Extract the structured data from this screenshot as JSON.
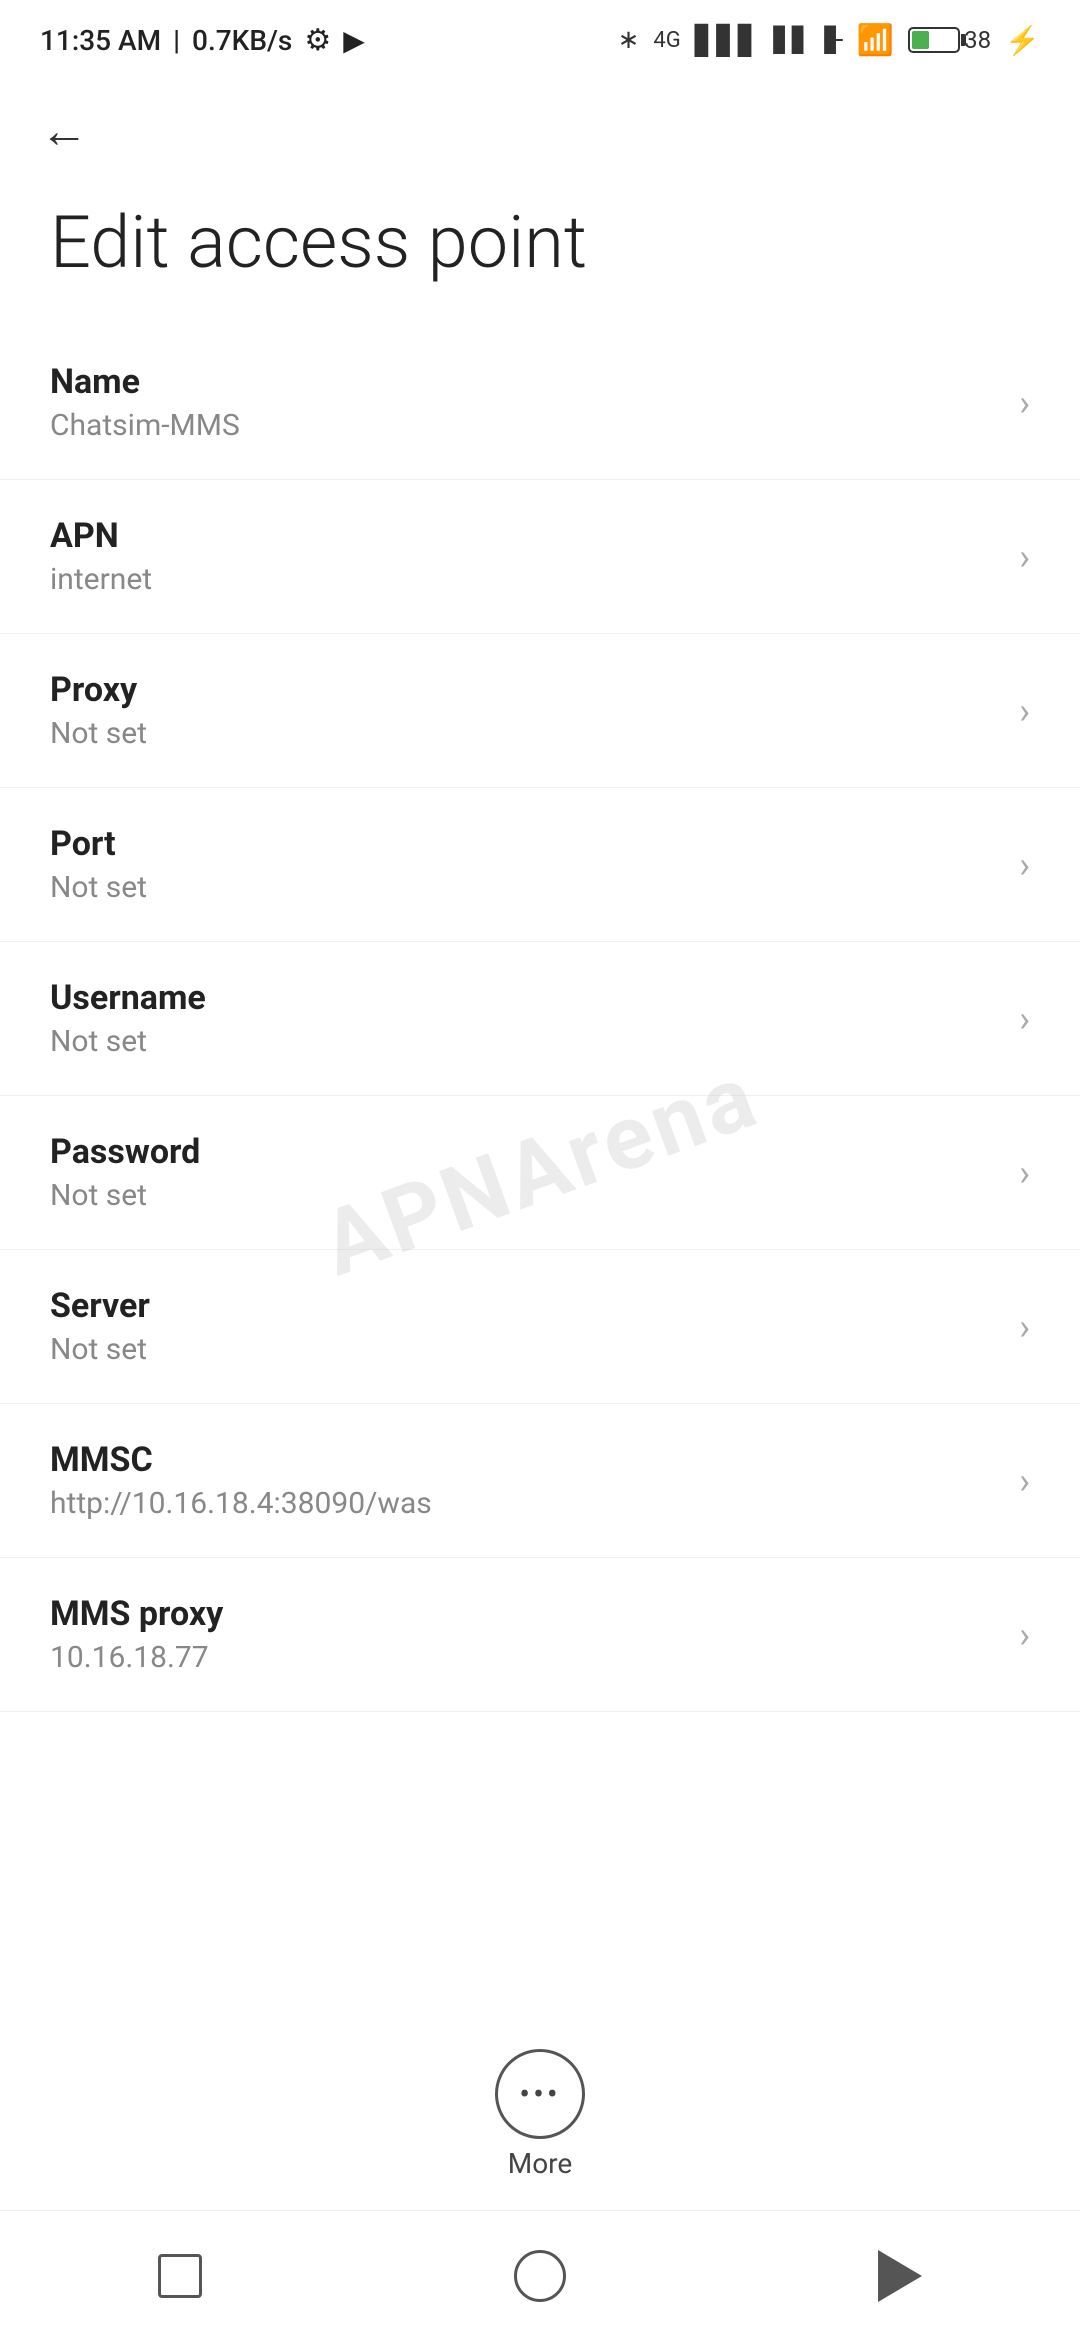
{
  "statusBar": {
    "time": "11:35 AM",
    "speed": "0.7KB/s"
  },
  "toolbar": {
    "backLabel": "←"
  },
  "pageTitle": "Edit access point",
  "settings": [
    {
      "id": "name",
      "label": "Name",
      "value": "Chatsim-MMS"
    },
    {
      "id": "apn",
      "label": "APN",
      "value": "internet"
    },
    {
      "id": "proxy",
      "label": "Proxy",
      "value": "Not set"
    },
    {
      "id": "port",
      "label": "Port",
      "value": "Not set"
    },
    {
      "id": "username",
      "label": "Username",
      "value": "Not set"
    },
    {
      "id": "password",
      "label": "Password",
      "value": "Not set"
    },
    {
      "id": "server",
      "label": "Server",
      "value": "Not set"
    },
    {
      "id": "mmsc",
      "label": "MMSC",
      "value": "http://10.16.18.4:38090/was"
    },
    {
      "id": "mms-proxy",
      "label": "MMS proxy",
      "value": "10.16.18.77"
    }
  ],
  "more": {
    "label": "More"
  },
  "watermark": "APNArena"
}
